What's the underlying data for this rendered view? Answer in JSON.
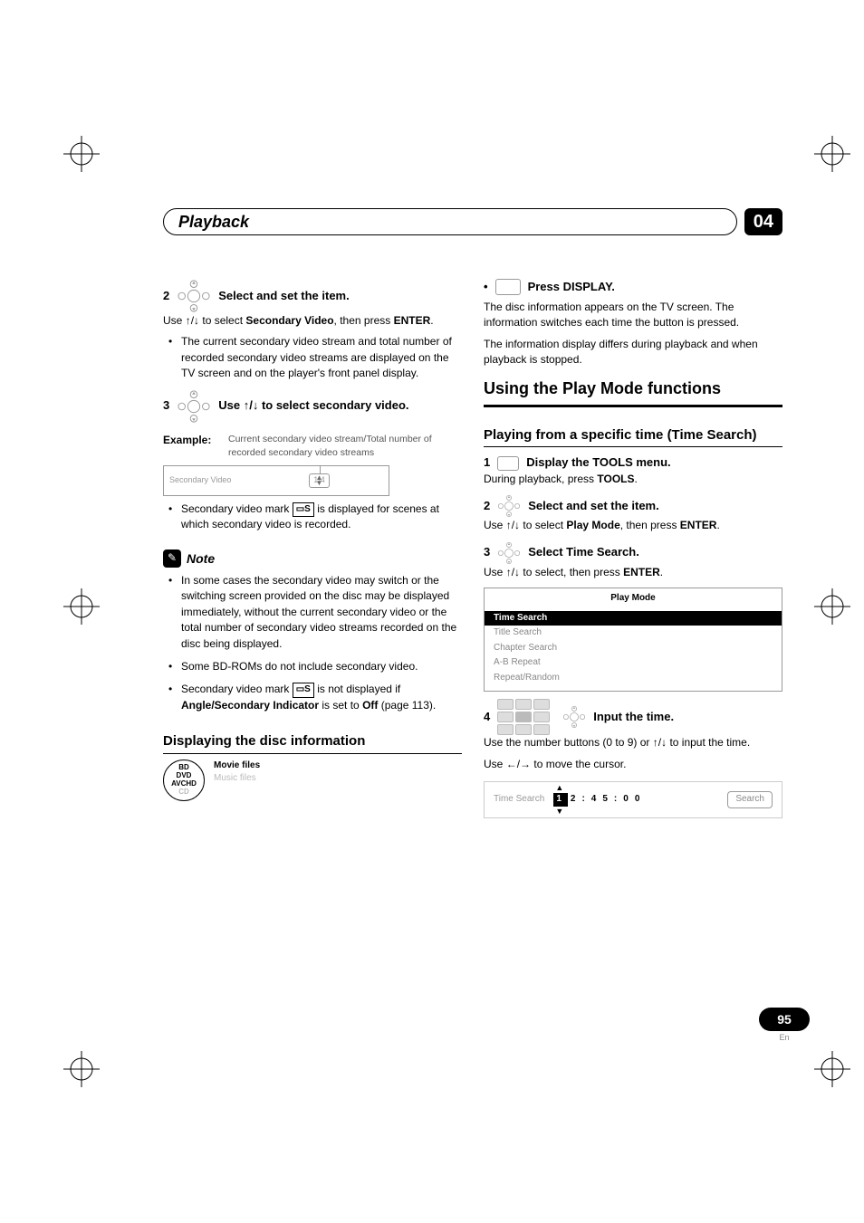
{
  "header": {
    "title": "Playback",
    "chapter": "04"
  },
  "left": {
    "step2": {
      "num": "2",
      "label": "Select and set the item.",
      "line1a": "Use ",
      "line1b": " to select ",
      "line1_bold": "Secondary Video",
      "line1c": ", then press ",
      "line1_enter": "ENTER",
      "line1d": "."
    },
    "step2_bullet": "The current secondary video stream and total number of recorded secondary video streams are displayed on the TV screen and on the player's front panel display.",
    "step3": {
      "num": "3",
      "label_a": "Use ",
      "label_b": " to select secondary video."
    },
    "example": {
      "label": "Example:",
      "desc": "Current secondary video stream/Total number of recorded secondary video streams"
    },
    "sv_box": {
      "label": "Secondary Video",
      "value": "1/4"
    },
    "sv_bullet_a": "Secondary video mark ",
    "sv_mark": "▭S",
    "sv_bullet_b": " is displayed for scenes at which secondary video is recorded.",
    "note_label": "Note",
    "note_items": [
      "In some cases the secondary video may switch or the switching screen provided on the disc may be displayed immediately, without the current secondary video or the total number of secondary video streams recorded on the disc being displayed.",
      "Some BD-ROMs do not include secondary video."
    ],
    "note_item3_a": "Secondary video mark ",
    "note_item3_b": " is not displayed if ",
    "note_item3_bold": "Angle/Secondary Indicator",
    "note_item3_c": " is set to ",
    "note_item3_off": "Off",
    "note_item3_d": " (page 113).",
    "disc_info_h": "Displaying the disc information",
    "formats": {
      "a1": "BD",
      "a2": "DVD",
      "a3": "AVCHD",
      "a4": "CD",
      "b1": "Movie files",
      "b2": "Music files"
    }
  },
  "right": {
    "press_display_label": "Press DISPLAY.",
    "press_display_p1": "The disc information appears on the TV screen. The information switches each time the button is pressed.",
    "press_display_p2": "The information display differs during playback and when playback is stopped.",
    "section_h": "Using the Play Mode functions",
    "subsection_h": "Playing from a specific time (Time Search)",
    "step1": {
      "num": "1",
      "label": "Display the TOOLS menu.",
      "line_a": "During playback, press ",
      "line_bold": "TOOLS",
      "line_b": "."
    },
    "step2": {
      "num": "2",
      "label": "Select and set the item.",
      "line_a": "Use ",
      "line_b": " to select ",
      "line_bold": "Play Mode",
      "line_c": ", then press ",
      "line_enter": "ENTER",
      "line_d": "."
    },
    "step3": {
      "num": "3",
      "label": "Select Time Search.",
      "line_a": "Use ",
      "line_b": " to select, then press ",
      "line_enter": "ENTER",
      "line_c": "."
    },
    "playmode": {
      "title": "Play Mode",
      "items": [
        "Time Search",
        "Title Search",
        "Chapter Search",
        "A-B Repeat",
        "Repeat/Random"
      ],
      "active_index": 0
    },
    "step4": {
      "num": "4",
      "label": "Input the time.",
      "line_a": "Use the number buttons (0 to 9) or ",
      "line_b": " to input the time.",
      "line2_a": "Use ",
      "line2_b": " to move the cursor."
    },
    "timesearch": {
      "label": "Time Search",
      "digits": [
        "1",
        "2",
        ":",
        "4",
        "5",
        ":",
        "0",
        "0"
      ],
      "button": "Search"
    }
  },
  "footer": {
    "page": "95",
    "lang": "En"
  },
  "arrows": {
    "updown": "↑/↓",
    "leftright": "←/→"
  }
}
